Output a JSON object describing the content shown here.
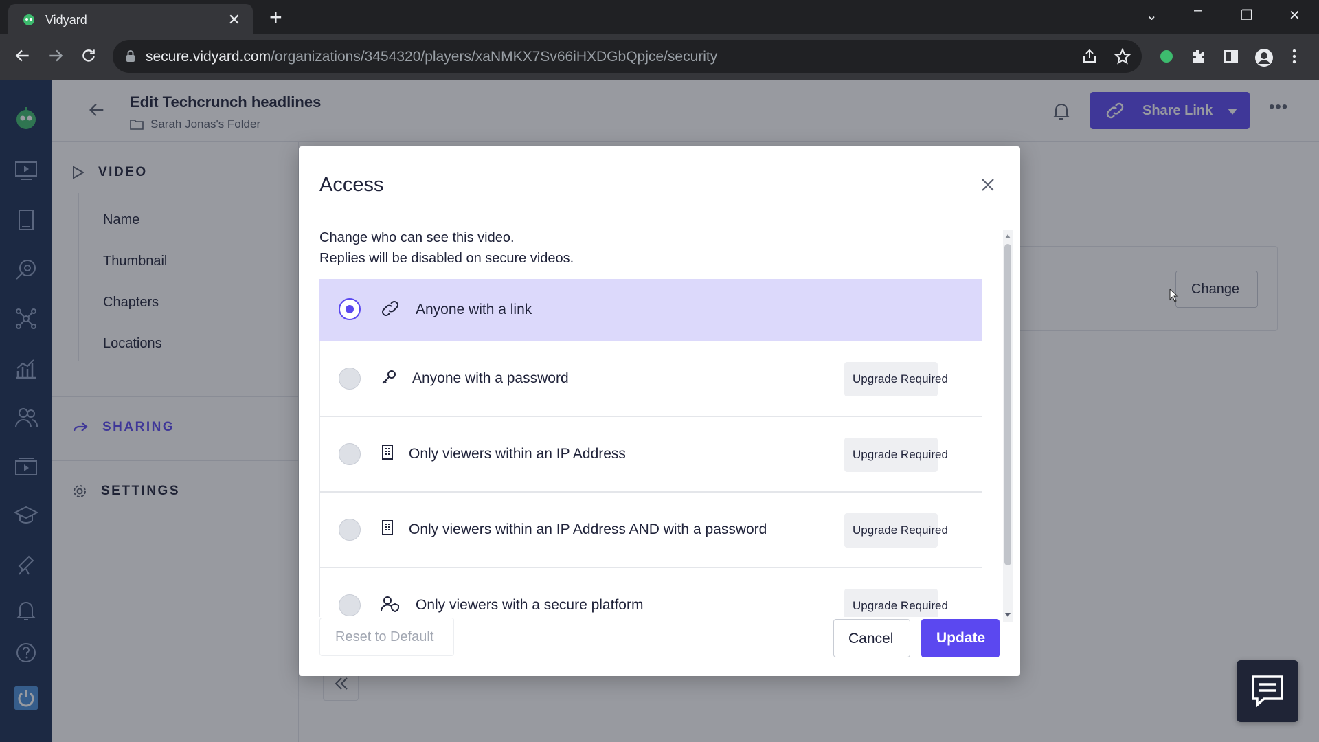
{
  "browser": {
    "tab_title": "Vidyard",
    "url_host": "secure.vidyard.com",
    "url_path": "/organizations/3454320/players/xaNMKX7Sv66iHXDGbQpjce/security"
  },
  "header": {
    "title": "Edit Techcrunch headlines",
    "folder": "Sarah Jonas's Folder",
    "share_label": "Share Link"
  },
  "sidebar": {
    "video_heading": "VIDEO",
    "video_items": [
      "Name",
      "Thumbnail",
      "Chapters",
      "Locations"
    ],
    "sharing_heading": "SHARING",
    "settings_heading": "SETTINGS"
  },
  "main": {
    "change_label": "Change"
  },
  "modal": {
    "title": "Access",
    "description_line1": "Change who can see this video.",
    "description_line2": "Replies will be disabled on secure videos.",
    "options": [
      {
        "label": "Anyone with a link",
        "icon": "link-icon",
        "selected": true,
        "badge": ""
      },
      {
        "label": "Anyone with a password",
        "icon": "key-icon",
        "selected": false,
        "badge": "Upgrade Required"
      },
      {
        "label": "Only viewers within an IP Address",
        "icon": "building-icon",
        "selected": false,
        "badge": "Upgrade Required"
      },
      {
        "label": "Only viewers within an IP Address AND with a password",
        "icon": "building-icon",
        "selected": false,
        "badge": "Upgrade Required"
      },
      {
        "label": "Only viewers with a secure platform",
        "icon": "user-shield-icon",
        "selected": false,
        "badge": "Upgrade Required"
      }
    ],
    "reset_label": "Reset to Default",
    "cancel_label": "Cancel",
    "update_label": "Update"
  },
  "colors": {
    "brand": "#5b48f0",
    "nav_bg": "#1b2f54",
    "selected_option_bg": "#dcd9fb"
  }
}
